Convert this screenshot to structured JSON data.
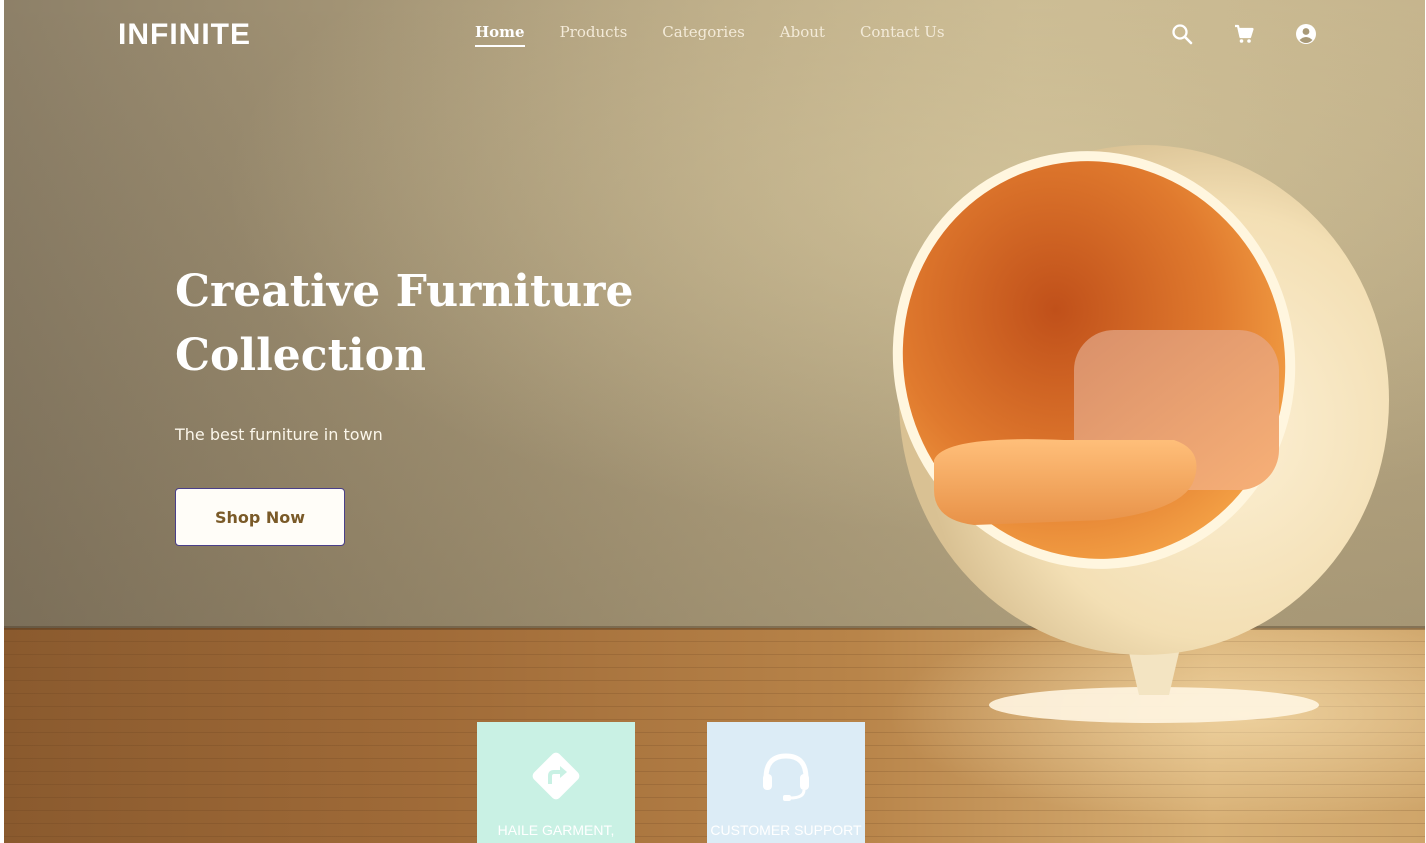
{
  "brand": {
    "logo_text": "INFINITE"
  },
  "nav": {
    "items": [
      {
        "label": "Home",
        "active": true
      },
      {
        "label": "Products",
        "active": false
      },
      {
        "label": "Categories",
        "active": false
      },
      {
        "label": "About",
        "active": false
      },
      {
        "label": "Contact Us",
        "active": false
      }
    ],
    "icons": [
      "search-icon",
      "cart-icon",
      "account-icon"
    ]
  },
  "hero": {
    "title_line1": "Creative Furniture",
    "title_line2": "Collection",
    "subtitle": "The best furniture in town",
    "cta_label": "Shop Now"
  },
  "features": [
    {
      "label": "HAILE GARMENT,",
      "icon": "directions-icon",
      "color": "#c9f1e4"
    },
    {
      "label": "CUSTOMER SUPPORT",
      "icon": "headset-icon",
      "color": "#dcecf6"
    }
  ],
  "colors": {
    "button_text": "#7a5a28",
    "button_border": "#4a3f8a"
  }
}
